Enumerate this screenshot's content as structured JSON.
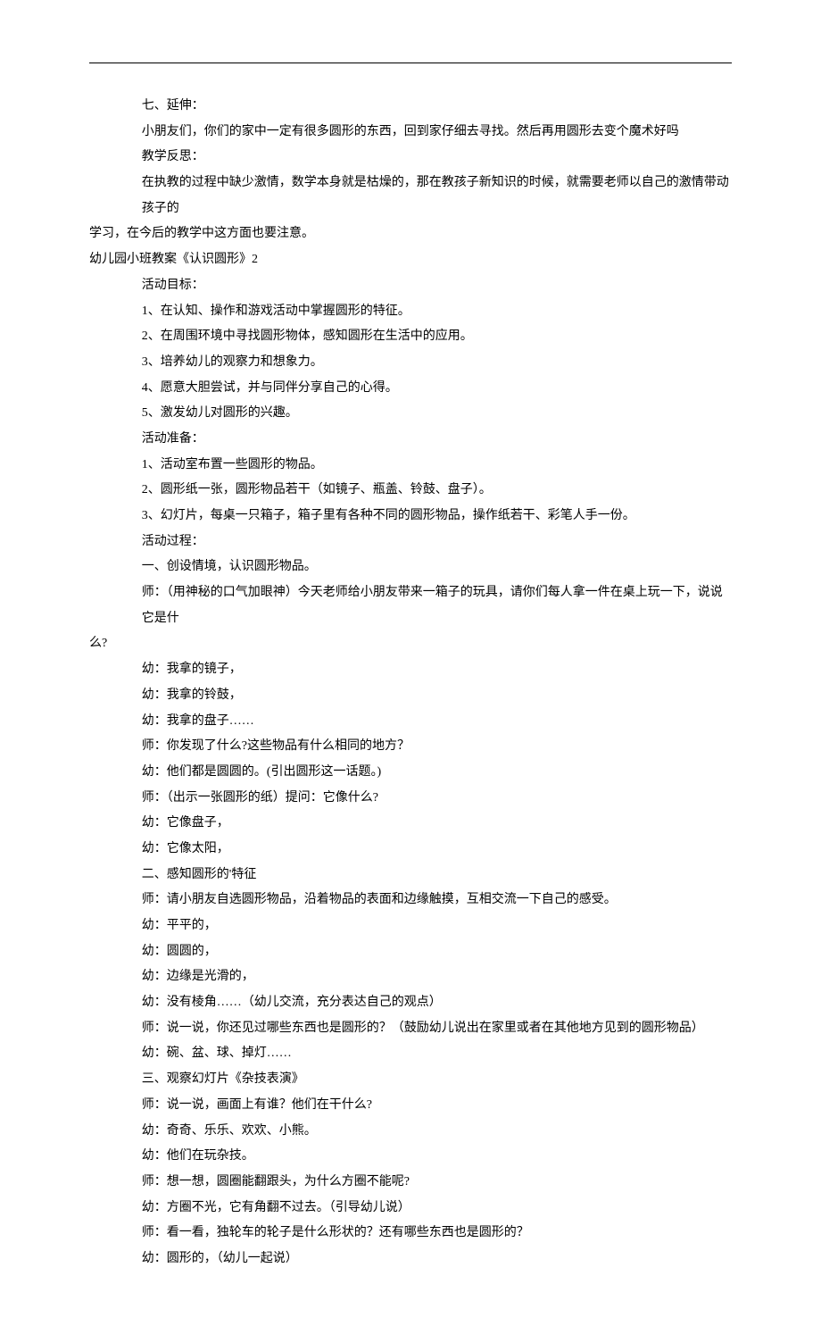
{
  "lines": [
    {
      "cls": "indent2",
      "text": "七、延伸："
    },
    {
      "cls": "indent2",
      "text": "小朋友们，你们的家中一定有很多圆形的东西，回到家仔细去寻找。然后再用圆形去变个魔术好吗"
    },
    {
      "cls": "indent2",
      "text": "教学反思："
    },
    {
      "cls": "indent2",
      "text": "在执教的过程中缺少激情，数学本身就是枯燥的，那在教孩子新知识的时候，就需要老师以自己的激情带动孩子的"
    },
    {
      "cls": "flush",
      "text": "学习，在今后的教学中这方面也要注意。"
    },
    {
      "cls": "flush",
      "text": "幼儿园小班教案《认识圆形》2"
    },
    {
      "cls": "indent2",
      "text": "活动目标："
    },
    {
      "cls": "indent2",
      "text": "1、在认知、操作和游戏活动中掌握圆形的特征。"
    },
    {
      "cls": "indent2",
      "text": "2、在周围环境中寻找圆形物体，感知圆形在生活中的应用。"
    },
    {
      "cls": "indent2",
      "text": "3、培养幼儿的观察力和想象力。"
    },
    {
      "cls": "indent2",
      "text": "4、愿意大胆尝试，并与同伴分享自己的心得。"
    },
    {
      "cls": "indent2",
      "text": "5、激发幼儿对圆形的兴趣。"
    },
    {
      "cls": "indent2",
      "text": "活动准备："
    },
    {
      "cls": "indent2",
      "text": "1、活动室布置一些圆形的物品。"
    },
    {
      "cls": "indent2",
      "text": "2、圆形纸一张，圆形物品若干（如镜子、瓶盖、铃鼓、盘子）。"
    },
    {
      "cls": "indent2",
      "text": "3、幻灯片，每桌一只箱子，箱子里有各种不同的圆形物品，操作纸若干、彩笔人手一份。"
    },
    {
      "cls": "indent2",
      "text": "活动过程："
    },
    {
      "cls": "indent2",
      "text": "一、创设情境，认识圆形物品。"
    },
    {
      "cls": "indent2",
      "text": "师：（用神秘的口气加眼神）今天老师给小朋友带来一箱子的玩具，请你们每人拿一件在桌上玩一下，说说它是什"
    },
    {
      "cls": "flush",
      "text": "么?"
    },
    {
      "cls": "indent2",
      "text": "幼：我拿的镜子，"
    },
    {
      "cls": "indent2",
      "text": "幼：我拿的铃鼓，"
    },
    {
      "cls": "indent2",
      "text": "幼：我拿的盘子……"
    },
    {
      "cls": "indent2",
      "text": "师：你发现了什么?这些物品有什么相同的地方？"
    },
    {
      "cls": "indent2",
      "text": "幼：他们都是圆圆的。(引出圆形这一话题。)"
    },
    {
      "cls": "indent2",
      "text": "师：（出示一张圆形的纸）提问：它像什么?"
    },
    {
      "cls": "indent2",
      "text": "幼：它像盘子，"
    },
    {
      "cls": "indent2",
      "text": "幼：它像太阳，"
    },
    {
      "cls": "indent2",
      "text": "二、感知圆形的'特征"
    },
    {
      "cls": "indent2",
      "text": "师：请小朋友自选圆形物品，沿着物品的表面和边缘触摸，互相交流一下自己的感受。"
    },
    {
      "cls": "indent2",
      "text": "幼：平平的，"
    },
    {
      "cls": "indent2",
      "text": "幼：圆圆的，"
    },
    {
      "cls": "indent2",
      "text": "幼：边缘是光滑的，"
    },
    {
      "cls": "indent2",
      "text": "幼：没有棱角……（幼儿交流，充分表达自己的观点）"
    },
    {
      "cls": "indent2",
      "text": "师：说一说，你还见过哪些东西也是圆形的？（鼓励幼儿说出在家里或者在其他地方见到的圆形物品）"
    },
    {
      "cls": "indent2",
      "text": "幼：碗、盆、球、掉灯……"
    },
    {
      "cls": "indent2",
      "text": "三、观察幻灯片《杂技表演》"
    },
    {
      "cls": "indent2",
      "text": "师：说一说，画面上有谁？他们在干什么?"
    },
    {
      "cls": "indent2",
      "text": "幼：奇奇、乐乐、欢欢、小熊。"
    },
    {
      "cls": "indent2",
      "text": "幼：他们在玩杂技。"
    },
    {
      "cls": "indent2",
      "text": "师：想一想，圆圈能翻跟头，为什么方圈不能呢?"
    },
    {
      "cls": "indent2",
      "text": "幼：方圈不光，它有角翻不过去。（引导幼儿说）"
    },
    {
      "cls": "indent2",
      "text": "师：看一看，独轮车的轮子是什么形状的？还有哪些东西也是圆形的？"
    },
    {
      "cls": "indent2",
      "text": "幼：圆形的，（幼儿一起说）"
    }
  ]
}
